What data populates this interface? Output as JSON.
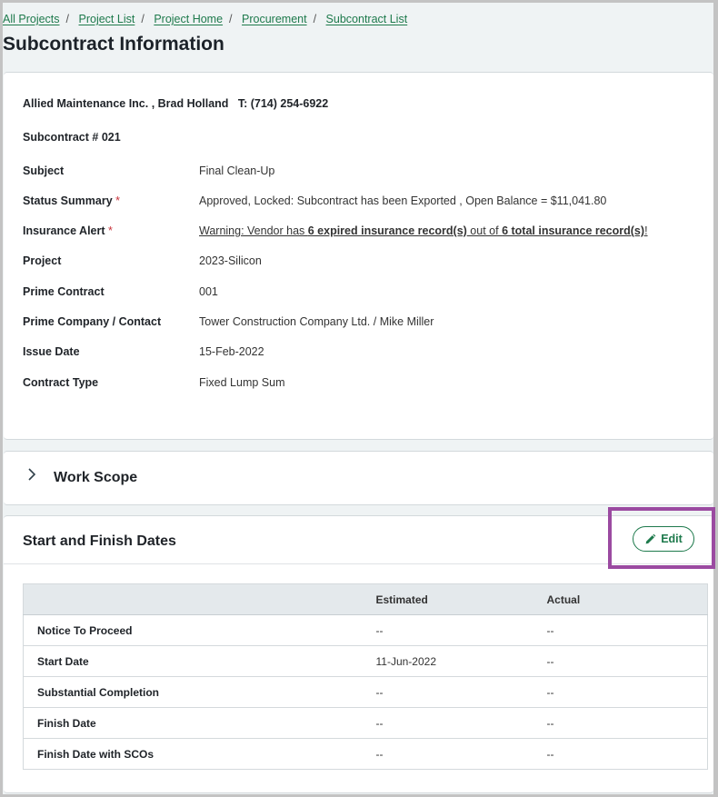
{
  "breadcrumb": [
    "All Projects",
    "Project List",
    "Project Home",
    "Procurement",
    "Subcontract List"
  ],
  "page_title": "Subcontract Information",
  "info": {
    "vendor_line": "Allied Maintenance Inc. , Brad Holland   T: (714) 254-6922",
    "subcontract_number": "Subcontract # 021",
    "fields": [
      {
        "label": "Subject",
        "value": "Final Clean-Up",
        "required": false
      },
      {
        "label": "Status Summary",
        "value": "Approved, Locked: Subcontract has been Exported , Open Balance = $11,041.80",
        "required": true
      },
      {
        "label": "Insurance Alert",
        "required": true,
        "warning": {
          "prefix": "Warning: Vendor has ",
          "expired": "6 expired insurance record(s)",
          "middle": " out of ",
          "total": "6 total insurance record(s)",
          "suffix": "!"
        }
      },
      {
        "label": "Project",
        "value": "2023-Silicon",
        "required": false
      },
      {
        "label": "Prime Contract",
        "value": "001",
        "required": false
      },
      {
        "label": "Prime Company / Contact",
        "value": "Tower Construction Company Ltd. / Mike Miller",
        "required": false
      },
      {
        "label": "Issue Date",
        "value": "15-Feb-2022",
        "required": false
      },
      {
        "label": "Contract Type",
        "value": "Fixed Lump Sum",
        "required": false
      }
    ],
    "required_marker": "*"
  },
  "work_scope": {
    "title": "Work Scope",
    "icon": "chevron-right-icon"
  },
  "dates": {
    "title": "Start and Finish Dates",
    "edit_label": "Edit",
    "edit_icon": "pencil-icon",
    "columns": [
      "",
      "Estimated",
      "Actual"
    ],
    "rows": [
      {
        "label": "Notice To Proceed",
        "estimated": "--",
        "actual": "--"
      },
      {
        "label": "Start Date",
        "estimated": "11-Jun-2022",
        "actual": "--"
      },
      {
        "label": "Substantial Completion",
        "estimated": "--",
        "actual": "--"
      },
      {
        "label": "Finish Date",
        "estimated": "--",
        "actual": "--"
      },
      {
        "label": "Finish Date with SCOs",
        "estimated": "--",
        "actual": "--"
      }
    ]
  },
  "colors": {
    "accent": "#1e7a4c",
    "required": "#c8323a",
    "highlight": "#9b4aa1"
  }
}
